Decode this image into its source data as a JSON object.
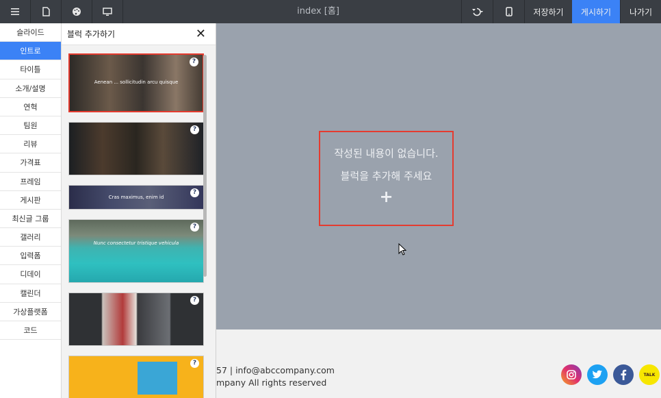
{
  "topbar": {
    "title": "index [홈]",
    "save_label": "저장하기",
    "publish_label": "게시하기",
    "exit_label": "나가기",
    "icons": [
      "menu-icon",
      "page-icon",
      "palette-icon",
      "monitor-icon",
      "undo-icon",
      "mobile-icon"
    ]
  },
  "categories": [
    "슬라이드",
    "인트로",
    "타이틀",
    "소개/설명",
    "연혁",
    "팀원",
    "리뷰",
    "가격표",
    "프레임",
    "게시판",
    "최신글 그룹",
    "갤러리",
    "입력폼",
    "디데이",
    "캘린더",
    "가상플랫폼",
    "코드"
  ],
  "active_category": "인트로",
  "panel": {
    "title": "블럭 추가하기",
    "help_glyph": "?",
    "thumb_captions": [
      "Aenean ... sollicitudin arcu quisque",
      "",
      "Cras maximus, enim id",
      "Nunc consectetur tristique vehicula",
      "",
      ""
    ]
  },
  "canvas": {
    "empty_line1": "작성된 내용이 없습니다.",
    "empty_line2": "블럭을 추가해 주세요",
    "add_glyph": "+"
  },
  "footer": {
    "contact": "57 | info@abccompany.com",
    "rights": "mpany All rights reserved",
    "kakao_label": "TALK"
  },
  "colors": {
    "accent": "#3b82f6",
    "highlight": "#e53b2f",
    "canvas_bg": "#9aa2ad",
    "topbar_bg": "#3a3e44"
  }
}
